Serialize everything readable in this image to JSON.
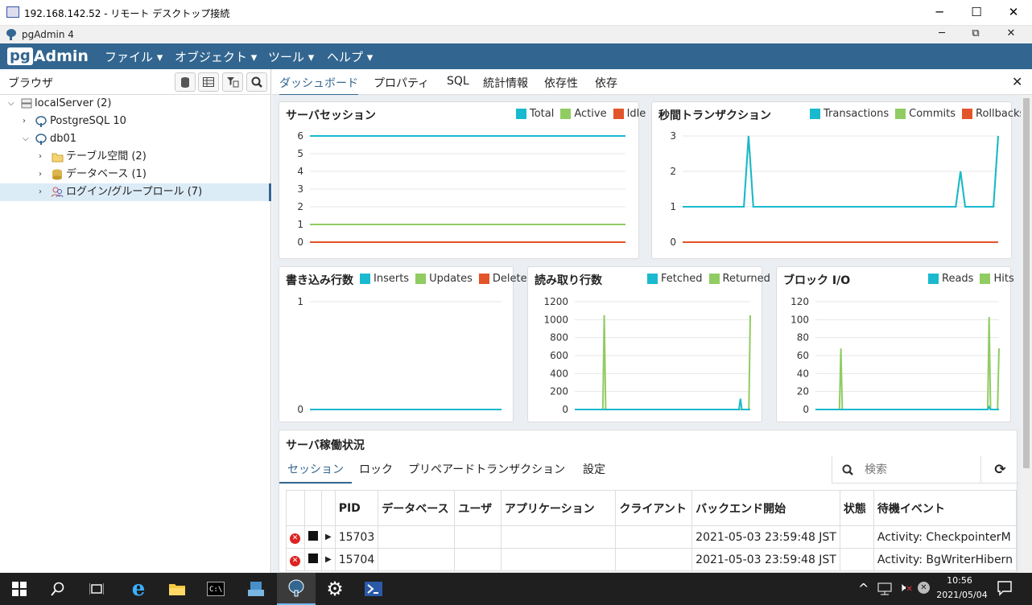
{
  "rdp": {
    "title": "192.168.142.52 - リモート デスクトップ接続",
    "min": "─",
    "max": "☐",
    "close": "✕"
  },
  "app_window": {
    "title": "pgAdmin 4",
    "min": "─",
    "restore": "⧉",
    "close": "✕"
  },
  "menubar": {
    "logo_pg": "pg",
    "logo_rest": "Admin",
    "items": [
      "ファイル",
      "オブジェクト",
      "ツール",
      "ヘルプ"
    ]
  },
  "browser": {
    "title": "ブラウザ",
    "tree": [
      {
        "label": "localServer (2)",
        "icon": "server-group-icon"
      },
      {
        "label": "PostgreSQL 10",
        "icon": "elephant-icon"
      },
      {
        "label": "db01",
        "icon": "elephant-icon"
      },
      {
        "label": "テーブル空間 (2)",
        "icon": "folder-icon"
      },
      {
        "label": "データベース (1)",
        "icon": "database-icon"
      },
      {
        "label": "ログイン/グループロール (7)",
        "icon": "roles-icon"
      }
    ]
  },
  "tabs": [
    "ダッシュボード",
    "プロパティ",
    "SQL",
    "統計情報",
    "依存性",
    "依存"
  ],
  "colors": {
    "accent": "#326690",
    "teal": "#19b9cf",
    "green": "#90cc62",
    "red": "#e2542a"
  },
  "charts": {
    "sessions": {
      "title": "サーバセッション",
      "legend": [
        "Total",
        "Active",
        "Idle"
      ]
    },
    "tps": {
      "title": "秒間トランザクション",
      "legend": [
        "Transactions",
        "Commits",
        "Rollbacks"
      ]
    },
    "writes": {
      "title": "書き込み行数",
      "legend": [
        "Inserts",
        "Updates",
        "Delete"
      ]
    },
    "reads": {
      "title": "読み取り行数",
      "legend": [
        "Fetched",
        "Returned"
      ]
    },
    "blocks": {
      "title": "ブロック I/O",
      "legend": [
        "Reads",
        "Hits"
      ]
    }
  },
  "chart_data": [
    {
      "type": "line",
      "title": "サーバセッション",
      "ylim": [
        0,
        6
      ],
      "yticks": [
        "0",
        "1",
        "2",
        "3",
        "4",
        "5",
        "6"
      ],
      "series": [
        {
          "name": "Total",
          "values": [
            6,
            6,
            6,
            6,
            6,
            6,
            6,
            6,
            6,
            6,
            6,
            6,
            6,
            6,
            6,
            6,
            6,
            6,
            6,
            6
          ]
        },
        {
          "name": "Active",
          "values": [
            1,
            1,
            1,
            1,
            1,
            1,
            1,
            1,
            1,
            1,
            1,
            1,
            1,
            1,
            1,
            1,
            1,
            1,
            1,
            1
          ]
        },
        {
          "name": "Idle",
          "values": [
            0,
            0,
            0,
            0,
            0,
            0,
            0,
            0,
            0,
            0,
            0,
            0,
            0,
            0,
            0,
            0,
            0,
            0,
            0,
            0
          ]
        }
      ]
    },
    {
      "type": "line",
      "title": "秒間トランザクション",
      "ylim": [
        0,
        3
      ],
      "yticks": [
        "0",
        "1",
        "2",
        "3"
      ],
      "series": [
        {
          "name": "Transactions",
          "values": [
            1,
            1,
            1,
            1,
            1,
            1,
            1,
            1,
            1,
            1,
            1,
            1,
            1,
            1,
            3,
            1,
            1,
            1,
            1,
            1,
            1,
            1,
            1,
            1,
            1,
            1,
            1,
            1,
            1,
            1,
            1,
            1,
            1,
            1,
            1,
            1,
            1,
            1,
            1,
            1,
            1,
            1,
            1,
            1,
            1,
            1,
            1,
            1,
            1,
            1,
            1,
            1,
            1,
            1,
            1,
            1,
            1,
            1,
            1,
            2,
            1,
            1,
            1,
            1,
            1,
            1,
            1,
            3
          ]
        },
        {
          "name": "Commits",
          "values": [
            1,
            1,
            1,
            1,
            1,
            1,
            1,
            1,
            1,
            1,
            1,
            1,
            1,
            1,
            3,
            1,
            1,
            1,
            1,
            1,
            1,
            1,
            1,
            1,
            1,
            1,
            1,
            1,
            1,
            1,
            1,
            1,
            1,
            1,
            1,
            1,
            1,
            1,
            1,
            1,
            1,
            1,
            1,
            1,
            1,
            1,
            1,
            1,
            1,
            1,
            1,
            1,
            1,
            1,
            1,
            1,
            1,
            1,
            1,
            2,
            1,
            1,
            1,
            1,
            1,
            1,
            1,
            3
          ]
        },
        {
          "name": "Rollbacks",
          "values": [
            0,
            0
          ]
        }
      ]
    },
    {
      "type": "line",
      "title": "書き込み行数",
      "ylim": [
        0,
        1
      ],
      "yticks": [
        "0",
        "1"
      ],
      "series": [
        {
          "name": "Inserts",
          "values": [
            0,
            0
          ]
        },
        {
          "name": "Updates",
          "values": [
            0,
            0
          ]
        },
        {
          "name": "Delete",
          "values": [
            0,
            0
          ]
        }
      ]
    },
    {
      "type": "line",
      "title": "読み取り行数",
      "ylim": [
        0,
        1200
      ],
      "yticks": [
        "0",
        "200",
        "400",
        "600",
        "800",
        "1000",
        "1200"
      ],
      "series": [
        {
          "name": "Fetched",
          "values": [
            0,
            0,
            0,
            0,
            0,
            0,
            0,
            0,
            0,
            0,
            0,
            0,
            0,
            0,
            0,
            0,
            0,
            0,
            0,
            0,
            0,
            0,
            0,
            0,
            0,
            0,
            0,
            0,
            0,
            0,
            0,
            0,
            0,
            0,
            0,
            0,
            0,
            0,
            0,
            0,
            0,
            0,
            0,
            0,
            0,
            0,
            0,
            0,
            0,
            0,
            0,
            0,
            0,
            0,
            0,
            0,
            0,
            0,
            0,
            0,
            0,
            0,
            0,
            0,
            0,
            0,
            0,
            0,
            0,
            0,
            0,
            0,
            0,
            0,
            0,
            0,
            0,
            0,
            0,
            0,
            0,
            0,
            0,
            0,
            0,
            0,
            0,
            0,
            0,
            0,
            0,
            0,
            0,
            0,
            0,
            0,
            0,
            0,
            0,
            0,
            0,
            0,
            0,
            0,
            0,
            0,
            0,
            0,
            0,
            0,
            0,
            0,
            0,
            0,
            0,
            0,
            0,
            0,
            120,
            0,
            0,
            0,
            0,
            0,
            0,
            0
          ]
        },
        {
          "name": "Returned",
          "values": [
            0,
            0,
            0,
            0,
            0,
            0,
            0,
            0,
            0,
            0,
            0,
            0,
            0,
            0,
            0,
            0,
            0,
            0,
            0,
            0,
            0,
            1050,
            0,
            0,
            0,
            0,
            0,
            0,
            0,
            0,
            0,
            0,
            0,
            0,
            0,
            0,
            0,
            0,
            0,
            0,
            0,
            0,
            0,
            0,
            0,
            0,
            0,
            0,
            0,
            0,
            0,
            0,
            0,
            0,
            0,
            0,
            0,
            0,
            0,
            0,
            0,
            0,
            0,
            0,
            0,
            0,
            0,
            0,
            0,
            0,
            0,
            0,
            0,
            0,
            0,
            0,
            0,
            0,
            0,
            0,
            0,
            0,
            0,
            0,
            0,
            0,
            0,
            0,
            0,
            0,
            0,
            0,
            0,
            0,
            0,
            0,
            0,
            0,
            0,
            0,
            0,
            0,
            0,
            0,
            0,
            0,
            0,
            0,
            0,
            0,
            0,
            0,
            0,
            0,
            0,
            0,
            0,
            0,
            0,
            0,
            0,
            0,
            0,
            0,
            0,
            1050
          ]
        }
      ]
    },
    {
      "type": "line",
      "title": "ブロック I/O",
      "ylim": [
        0,
        120
      ],
      "yticks": [
        "0",
        "20",
        "40",
        "60",
        "80",
        "100",
        "120"
      ],
      "series": [
        {
          "name": "Reads",
          "values": [
            0,
            0,
            0,
            0,
            0,
            0,
            0,
            0,
            0,
            0,
            0,
            0,
            0,
            0,
            0,
            0,
            0,
            0,
            0,
            0,
            0,
            0,
            0,
            0,
            0,
            0,
            0,
            0,
            0,
            0,
            0,
            0,
            0,
            0,
            0,
            0,
            0,
            0,
            0,
            0,
            0,
            0,
            0,
            0,
            0,
            0,
            0,
            0,
            0,
            0,
            0,
            0,
            0,
            0,
            0,
            0,
            0,
            0,
            0,
            0,
            0,
            0,
            0,
            0,
            0,
            0,
            0,
            0,
            0,
            0,
            0,
            0,
            0,
            0,
            0,
            0,
            0,
            0,
            0,
            0,
            0,
            0,
            0,
            0,
            0,
            0,
            0,
            0,
            0,
            0,
            0,
            0,
            0,
            0,
            0,
            0,
            0,
            0,
            0,
            0,
            0,
            0,
            0,
            0,
            0,
            0,
            0,
            0,
            0,
            0,
            0,
            0,
            0,
            0,
            0,
            0,
            0,
            0,
            0,
            0,
            0,
            0,
            3,
            0,
            0,
            0,
            0,
            0,
            0,
            0
          ]
        },
        {
          "name": "Hits",
          "values": [
            0,
            0,
            0,
            0,
            0,
            0,
            0,
            0,
            0,
            0,
            0,
            0,
            0,
            0,
            0,
            0,
            0,
            0,
            68,
            0,
            0,
            0,
            0,
            0,
            0,
            0,
            0,
            0,
            0,
            0,
            0,
            0,
            0,
            0,
            0,
            0,
            0,
            0,
            0,
            0,
            0,
            0,
            0,
            0,
            0,
            0,
            0,
            0,
            0,
            0,
            0,
            0,
            0,
            0,
            0,
            0,
            0,
            0,
            0,
            0,
            0,
            0,
            0,
            0,
            0,
            0,
            0,
            0,
            0,
            0,
            0,
            0,
            0,
            0,
            0,
            0,
            0,
            0,
            0,
            0,
            0,
            0,
            0,
            0,
            0,
            0,
            0,
            0,
            0,
            0,
            0,
            0,
            0,
            0,
            0,
            0,
            0,
            0,
            0,
            0,
            0,
            0,
            0,
            0,
            0,
            0,
            0,
            0,
            0,
            0,
            0,
            0,
            0,
            0,
            0,
            0,
            0,
            0,
            0,
            0,
            0,
            0,
            0,
            103,
            0,
            0,
            0,
            0,
            0,
            0,
            68
          ]
        }
      ]
    }
  ],
  "activity": {
    "title": "サーバ稼働状況",
    "tabs": [
      "セッション",
      "ロック",
      "プリペアードトランザクション",
      "設定"
    ],
    "search_placeholder": "検索",
    "columns": [
      "",
      "",
      "",
      "PID",
      "データベース",
      "ユーザ",
      "アプリケーション",
      "クライアント",
      "バックエンド開始",
      "状態",
      "待機イベント"
    ],
    "rows": [
      {
        "pid": "15703",
        "db": "",
        "user": "",
        "app": "",
        "client": "",
        "start": "2021-05-03 23:59:48 JST",
        "state": "",
        "wait": "Activity: CheckpointerM"
      },
      {
        "pid": "15704",
        "db": "",
        "user": "",
        "app": "",
        "client": "",
        "start": "2021-05-03 23:59:48 JST",
        "state": "",
        "wait": "Activity: BgWriterHibern"
      }
    ]
  },
  "taskbar": {
    "time": "10:56",
    "date": "2021/05/04"
  }
}
